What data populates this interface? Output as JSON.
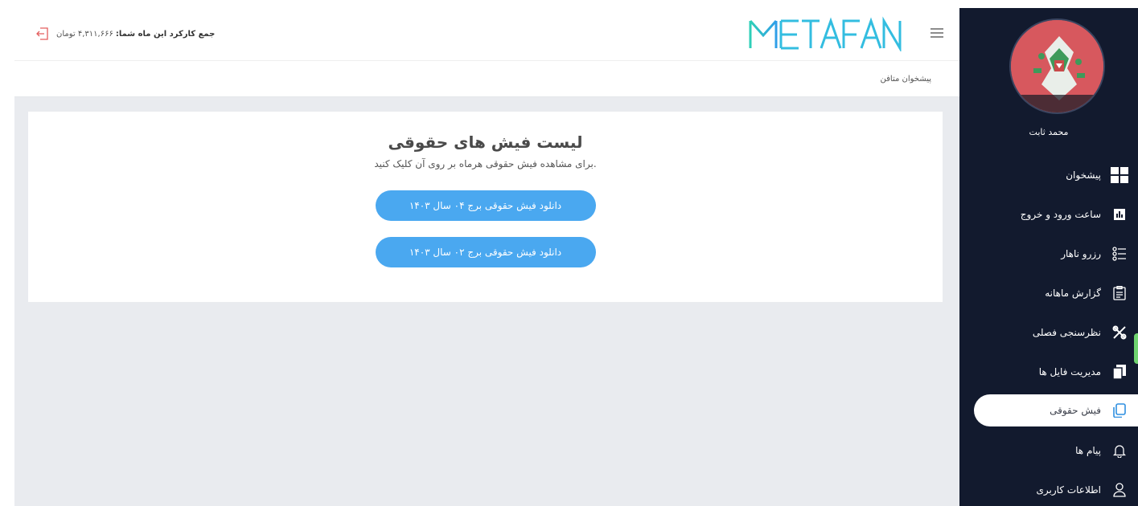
{
  "header": {
    "logo_text": "METAFAN",
    "income_label": "جمع کارکرد این ماه شما:",
    "income_value": "۴,۳۱۱,۶۶۶ تومان"
  },
  "breadcrumb": "پیشخوان متافن",
  "user": {
    "name": "محمد ثابت"
  },
  "sidebar": {
    "items": [
      {
        "label": "پیشخوان",
        "icon": "dashboard-icon"
      },
      {
        "label": "ساعت ورود و خروج",
        "icon": "chart-icon"
      },
      {
        "label": "رزرو ناهار",
        "icon": "list-icon"
      },
      {
        "label": "گزارش ماهانه",
        "icon": "clipboard-icon"
      },
      {
        "label": "نظرسنجی فصلی",
        "icon": "tools-icon"
      },
      {
        "label": "مدیریت فایل ها",
        "icon": "files-icon"
      },
      {
        "label": "فیش حقوقی",
        "icon": "copy-icon",
        "active": true
      },
      {
        "label": "پیام ها",
        "icon": "bell-icon"
      },
      {
        "label": "اطلاعات کاربری",
        "icon": "user-icon"
      }
    ]
  },
  "main": {
    "title": "لیست فیش های حقوقی",
    "subtitle": "برای مشاهده فیش حقوقی هرماه بر روی آن کلیک کنید.",
    "buttons": [
      "دانلود فیش حقوقی برج ۰۴ سال ۱۴۰۳",
      "دانلود فیش حقوقی برج ۰۲ سال ۱۴۰۳"
    ]
  },
  "colors": {
    "sidebar_bg": "#121a2e",
    "accent_blue": "#4aa8f0",
    "logo_cyan": "#2fc3e8",
    "content_bg": "#e9ebef"
  }
}
